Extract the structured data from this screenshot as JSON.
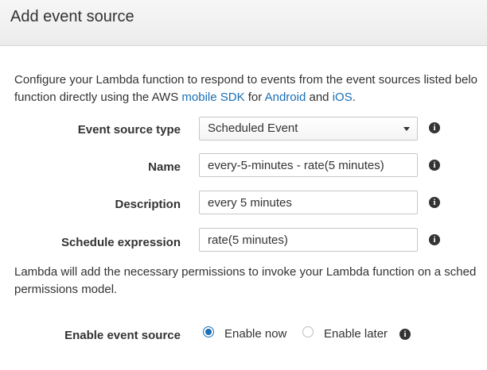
{
  "header": {
    "title": "Add event source"
  },
  "intro": {
    "line1": "Configure your Lambda function to respond to events from the event sources listed belo",
    "line2_prefix": "function directly using the AWS ",
    "link_mobile_sdk": "mobile SDK",
    "line2_for": " for ",
    "link_android": "Android",
    "line2_and": " and ",
    "link_ios": "iOS",
    "line2_suffix": "."
  },
  "form": {
    "event_source_type": {
      "label": "Event source type",
      "value": "Scheduled Event",
      "info_icon": "info-icon"
    },
    "name": {
      "label": "Name",
      "value": "every-5-minutes - rate(5 minutes)",
      "info_icon": "info-icon"
    },
    "description": {
      "label": "Description",
      "value": "every 5 minutes",
      "info_icon": "info-icon"
    },
    "schedule_expression": {
      "label": "Schedule expression",
      "value": "rate(5 minutes)",
      "info_icon": "info-icon"
    }
  },
  "permissions_note": {
    "line1": "Lambda will add the necessary permissions to invoke your Lambda function on a sched",
    "line2": "permissions model."
  },
  "enable": {
    "label": "Enable event source",
    "option_now": "Enable now",
    "option_later": "Enable later",
    "selected": "Enable now"
  },
  "colors": {
    "link": "#1a6fb5",
    "radio_selected": "#1a6fb5",
    "header_bg": "#efefef",
    "text": "#333333"
  }
}
